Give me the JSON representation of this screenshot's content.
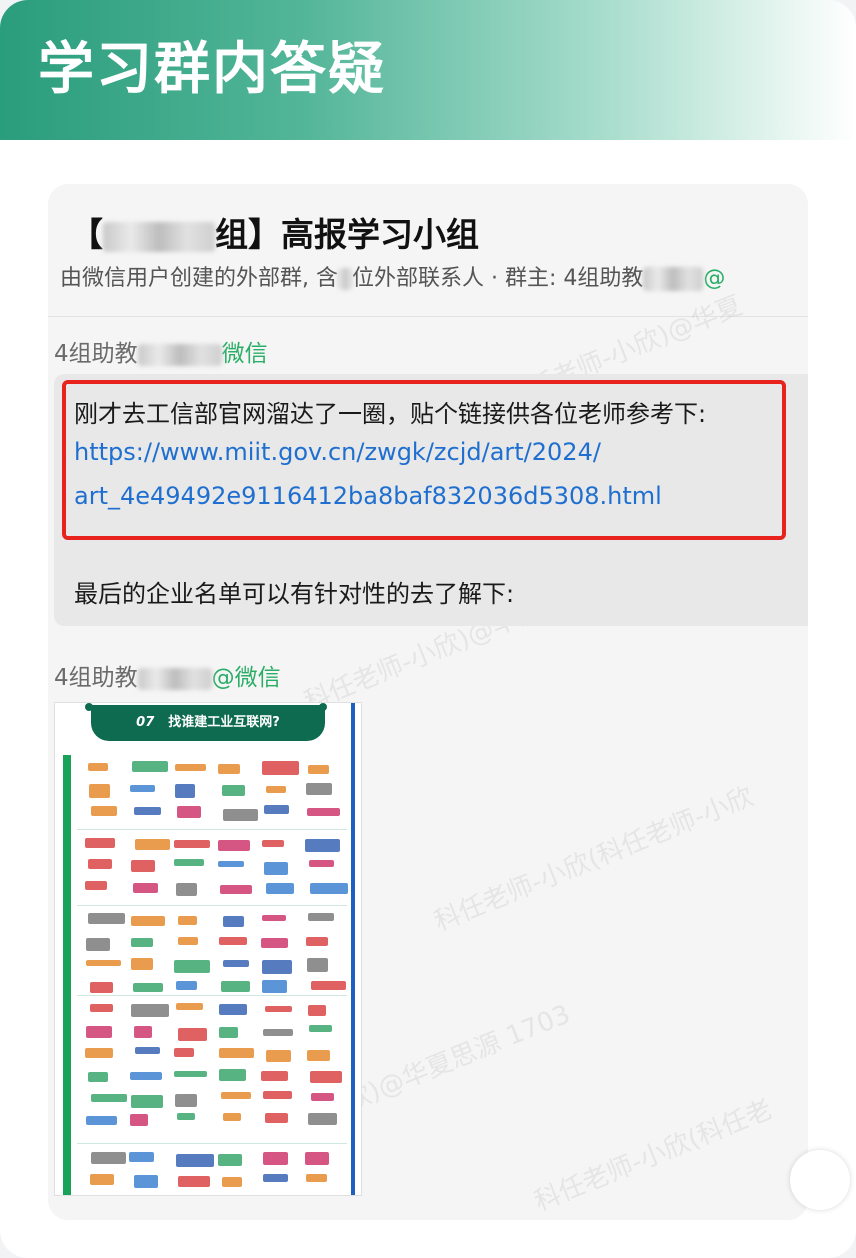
{
  "banner": {
    "title": "学习群内答疑"
  },
  "group": {
    "name_prefix": "【",
    "name_suffix": "组】高报学习小组",
    "desc_prefix": "由微信用户创建的外部群, 含",
    "desc_mid": "位外部联系人 · 群主: 4组助教",
    "desc_suffix": "@"
  },
  "messages": [
    {
      "sender_prefix": "4组助教",
      "sender_suffix": "微信",
      "text": "刚才去工信部官网溜达了一圈，贴个链接供各位老师参考下:",
      "link_line1": "https://www.miit.gov.cn/zwgk/zcjd/art/2024/",
      "link_line2": "art_4e49492e9116412ba8baf832036d5308.html",
      "text2": "最后的企业名单可以有针对性的去了解下:"
    },
    {
      "sender_prefix": "4组助教",
      "sender_suffix": "@微信",
      "image_title": "找谁建工业互联网?",
      "image_number": "07"
    }
  ],
  "watermarks": [
    "科任老师-小欣)@华夏",
    "科任老师-小欣)@华夏",
    "科任老师-小欣(科任老师-小欣",
    "欣)@华夏思源 1703",
    "科任老师-小欣(科任老"
  ],
  "colors": {
    "accent": "#2a9d7c",
    "link": "#1f6fd0",
    "highlight": "#e8231d",
    "wechat": "#2aae67"
  }
}
